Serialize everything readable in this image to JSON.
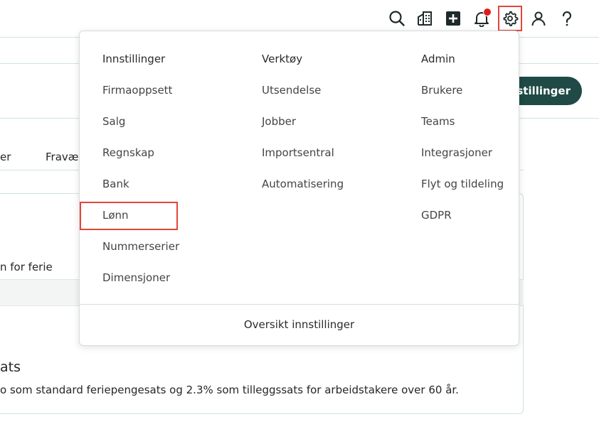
{
  "topbar": {
    "icons": [
      "search-icon",
      "company-building-icon",
      "add-icon",
      "notification-bell-icon",
      "settings-gear-icon",
      "user-icon",
      "help-icon"
    ]
  },
  "background": {
    "settings_button_label": "nnstillinger",
    "tab_partial_left": "er",
    "tab_absence": "Fravær",
    "row_text": "n for ferie",
    "section_title": "ats",
    "description": "o som standard feriepengesats og 2.3% som tilleggssats for arbeidstakere over 60 år."
  },
  "dropdown": {
    "columns": [
      {
        "header": "Innstillinger",
        "items": [
          "Firmaoppsett",
          "Salg",
          "Regnskap",
          "Bank",
          "Lønn",
          "Nummerserier",
          "Dimensjoner"
        ]
      },
      {
        "header": "Verktøy",
        "items": [
          "Utsendelse",
          "Jobber",
          "Importsentral",
          "Automatisering"
        ]
      },
      {
        "header": "Admin",
        "items": [
          "Brukere",
          "Teams",
          "Integrasjoner",
          "Flyt og tildeling",
          "GDPR"
        ]
      }
    ],
    "footer": "Oversikt innstillinger"
  },
  "colors": {
    "accent_dark": "#1f4a45",
    "highlight": "#e0463a",
    "notification": "#e01b1b"
  }
}
